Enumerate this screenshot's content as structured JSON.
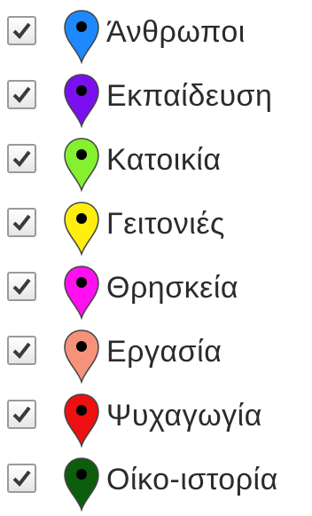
{
  "layers": [
    {
      "label": "Άνθρωποι",
      "checked": true,
      "marker_color": "#1e88ff",
      "icon": "map-pin-icon"
    },
    {
      "label": "Εκπαίδευση",
      "checked": true,
      "marker_color": "#7a10ee",
      "icon": "map-pin-icon"
    },
    {
      "label": "Κατοικία",
      "checked": true,
      "marker_color": "#84f030",
      "icon": "map-pin-icon"
    },
    {
      "label": "Γειτονιές",
      "checked": true,
      "marker_color": "#ffee10",
      "icon": "map-pin-icon"
    },
    {
      "label": "Θρησκεία",
      "checked": true,
      "marker_color": "#ff10ee",
      "icon": "map-pin-icon"
    },
    {
      "label": "Εργασία",
      "checked": true,
      "marker_color": "#f7927a",
      "icon": "map-pin-icon"
    },
    {
      "label": "Ψυχαγωγία",
      "checked": true,
      "marker_color": "#ee1010",
      "icon": "map-pin-icon"
    },
    {
      "label": "Οίκο-ιστορία",
      "checked": true,
      "marker_color": "#0c5e0c",
      "icon": "map-pin-icon"
    }
  ]
}
